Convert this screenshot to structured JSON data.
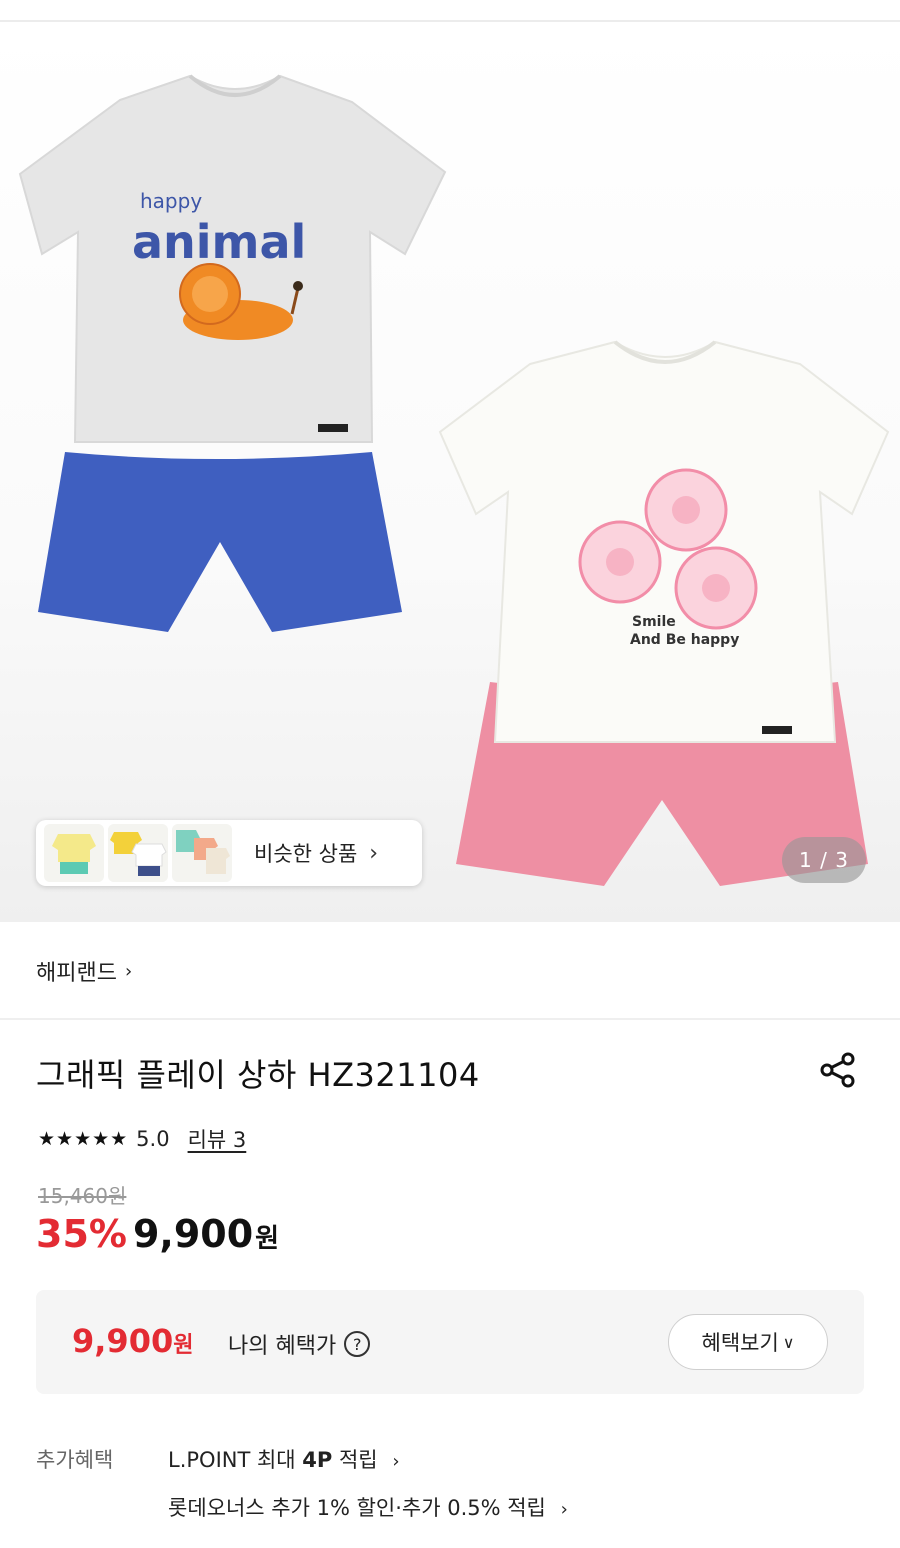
{
  "gallery": {
    "shirt1_text_top": "happy",
    "shirt1_text_main": "animal",
    "shirt2_text_line1": "Smile",
    "shirt2_text_line2": "And Be happy",
    "similar_label": "비슷한 상품",
    "counter": "1 / 3"
  },
  "brand": {
    "name": "해피랜드"
  },
  "product": {
    "title": "그래픽 플레이 상하 HZ321104",
    "stars": "★★★★★",
    "score": "5.0",
    "review": "리뷰 3",
    "original_price": "15,460원",
    "discount": "35%",
    "price": "9,900",
    "won": "원"
  },
  "benefit": {
    "price": "9,900",
    "won": "원",
    "label": "나의 혜택가",
    "help": "?",
    "button": "혜택보기"
  },
  "extra": {
    "label": "추가혜택",
    "line1_prefix": "L.POINT 최대 ",
    "line1_bold": "4P",
    "line1_suffix": " 적립",
    "line2": "롯데오너스 추가 1% 할인·추가 0.5% 적립"
  },
  "colors": {
    "accent_red": "#e32b33",
    "shorts_blue": "#3f5fc0",
    "shorts_pink": "#ee8fa3",
    "shirt_gray": "#e6e6e6"
  }
}
